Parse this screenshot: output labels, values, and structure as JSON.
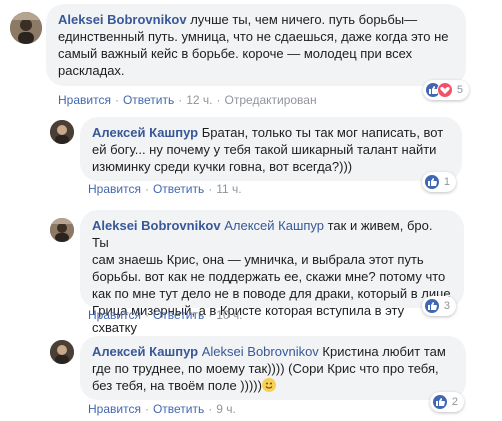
{
  "comments": [
    {
      "author": "Aleksei Bobrovnikov",
      "mention": "",
      "text_lines": [
        " лучше ты, чем ничего. путь борьбы—",
        "единственный путь. умница, что не сдаешься, даже когда это не",
        "самый важный кейс в борьбе. короче — молодец при всех",
        "раскладах."
      ],
      "like_label": "Нравится",
      "reply_label": "Ответить",
      "time": "12 ч.",
      "edited": "Отредактирован",
      "reaction_count": "5"
    },
    {
      "author": "Алексей Кашпур",
      "mention": "",
      "text_lines": [
        " Братан, только ты так мог написать, вот",
        "ей богу... ну почему у тебя такой шикарный талант найти",
        "изюминку среди кучки говна, вот всегда?)))"
      ],
      "like_label": "Нравится",
      "reply_label": "Ответить",
      "time": "11 ч.",
      "reaction_count": "1"
    },
    {
      "author": "Aleksei Bobrovnikov",
      "mention": "Алексей Кашпур",
      "text_lines": [
        " так и живем, бро. Ты",
        "сам знаешь Крис, она — умничка, и выбрала этот путь",
        "борьбы. вот как не поддержать ее, скажи мне? потому что",
        "как по мне тут дело не в поводе для драки, который в лице",
        "Грица мизерный, а в Кристе которая вступила в эту схватку"
      ],
      "like_label": "Нравится",
      "reply_label": "Ответить",
      "time": "10 ч.",
      "reaction_count": "3"
    },
    {
      "author": "Алексей Кашпур",
      "mention": "Aleksei Bobrovnikov",
      "text_lines": [
        " Кристина любит там",
        "где по труднее, по моему так)))) (Сори Крис что про тебя,",
        "без тебя, на твоём поле   )))))"
      ],
      "like_label": "Нравится",
      "reply_label": "Ответить",
      "time": "9 ч.",
      "reaction_count": "2"
    }
  ],
  "colors": {
    "link": "#385898",
    "bubble": "#f2f3f5",
    "like": "#4267b2",
    "love": "#f25268"
  }
}
